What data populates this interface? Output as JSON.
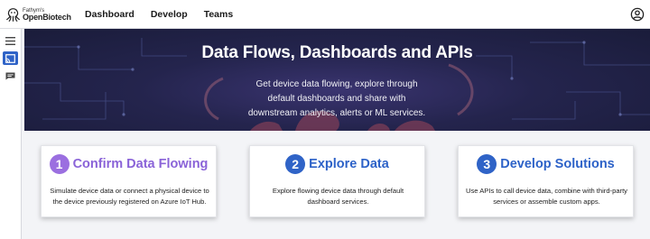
{
  "brand": {
    "line1": "Fathym's",
    "line2": "OpenBiotech"
  },
  "nav": [
    "Dashboard",
    "Develop",
    "Teams"
  ],
  "hero": {
    "title": "Data Flows, Dashboards and APIs",
    "subtitle": "Get device data flowing, explore through default dashboards and share with downstream analytics, alerts or ML services."
  },
  "cards": [
    {
      "number": "1",
      "title": "Confirm Data Flowing",
      "body": "Simulate device data or connect a physical device to the device previously registered on Azure IoT Hub.",
      "badge_color": "#9b6fe0",
      "title_color": "#8a63d8"
    },
    {
      "number": "2",
      "title": "Explore Data",
      "body": "Explore flowing device data through default dashboard services.",
      "badge_color": "#2f63c7",
      "title_color": "#2d62c8"
    },
    {
      "number": "3",
      "title": "Develop Solutions",
      "body": "Use APIs to call device data, combine with third-party services or assemble custom apps.",
      "badge_color": "#2f63c7",
      "title_color": "#2d62c8"
    }
  ],
  "icons": {
    "account": "account-circle-icon",
    "menu": "hamburger-menu-icon",
    "devices": "cast-icon",
    "messages": "message-icon"
  },
  "colors": {
    "accent": "#2f63c7",
    "hero_bg": "#24244d"
  }
}
